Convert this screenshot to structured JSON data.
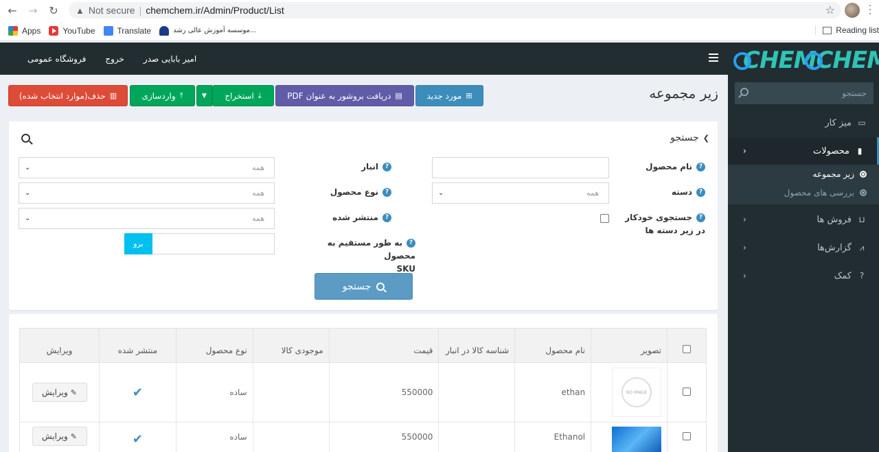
{
  "browser": {
    "not_secure": "Not secure",
    "url": "chemchem.ir/Admin/Product/List",
    "bookmarks": [
      "Apps",
      "YouTube",
      "Translate",
      "موسسه آموزش عالی رشد..."
    ],
    "reading_list": "Reading list"
  },
  "header": {
    "links": [
      "امیر بابایی صدر",
      "خروج",
      "فروشگاه عمومی"
    ]
  },
  "sidebar": {
    "logo": "CHEMCHEM",
    "search_placeholder": "جستجو",
    "items": [
      {
        "label": "میز کار",
        "icon": "monitor-icon"
      },
      {
        "label": "محصولات",
        "icon": "book-icon"
      },
      {
        "label": "فروش ها",
        "icon": "cart-icon"
      },
      {
        "label": "گزارش‌ها",
        "icon": "chart-icon"
      },
      {
        "label": "کمک",
        "icon": "help-icon"
      }
    ],
    "subitems": [
      "زیر مجموعه",
      "بررسی های محصول"
    ]
  },
  "page": {
    "title": "زیر مجموعه",
    "buttons": {
      "new": "مورد جدید",
      "pdf": "دریافت بروشور به عنوان PDF",
      "export": "استخراج",
      "import": "واردسازی",
      "delete": "حذف(موارد انتخاب شده)"
    }
  },
  "search": {
    "title": "جستجو",
    "product_name": "نام محصول",
    "category": "دسته",
    "subcat_line1": "جستجوی خودکار",
    "subcat_line2": "در زیر دسته ها",
    "warehouse": "انبار",
    "product_type": "نوع محصول",
    "published": "منتشر شده",
    "sku_line1": "به طور مستقیم به محصول",
    "sku_line2": "SKU",
    "all": "همه",
    "go": "برو",
    "search_button": "جستجو"
  },
  "table": {
    "headers": {
      "image": "تصویر",
      "name": "نام محصول",
      "sku": "شناسه کالا در انبار",
      "price": "قیمت",
      "stock": "موجودی کالا",
      "type": "نوع محصول",
      "published": "منتشر شده",
      "edit": "ویرایش"
    },
    "no_image": "NO IMAGE",
    "edit_label": "ویرایش",
    "rows": [
      {
        "name": "ethan",
        "sku": "",
        "price": "550000",
        "stock": "",
        "type": "ساده",
        "published": "✔"
      },
      {
        "name": "Ethanol",
        "sku": "",
        "price": "550000",
        "stock": "",
        "type": "ساده",
        "published": "✔"
      }
    ]
  }
}
